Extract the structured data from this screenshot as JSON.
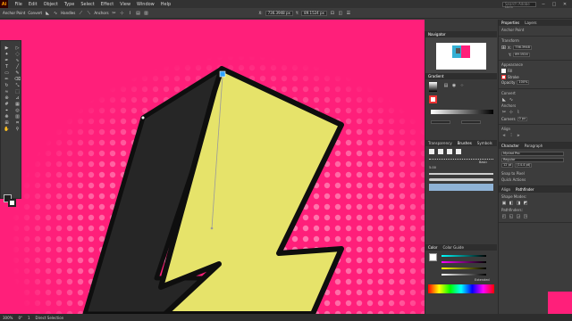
{
  "app": {
    "logo": "Ai"
  },
  "menu": [
    "File",
    "Edit",
    "Object",
    "Type",
    "Select",
    "Effect",
    "View",
    "Window",
    "Help"
  ],
  "search": {
    "placeholder": "Search Adobe Help"
  },
  "window_controls": [
    "─",
    "□",
    "✕"
  ],
  "control_bar": {
    "anchor_label": "Anchor Point",
    "convert_label": "Convert",
    "handles_label": "Handles",
    "anchors_label": "Anchors",
    "x_value": "736.3948 px",
    "y_value": "89.1524 px"
  },
  "tools": [
    "pointer",
    "direct-select",
    "magic-wand",
    "lasso",
    "pen",
    "curvature",
    "type",
    "line",
    "rectangle",
    "paintbrush",
    "pencil",
    "eraser",
    "rotate",
    "scale",
    "warp",
    "free-transform",
    "shape-builder",
    "perspective",
    "mesh",
    "gradient",
    "eyedropper",
    "blend",
    "symbol-sprayer",
    "column-graph",
    "artboard",
    "slice",
    "hand",
    "zoom"
  ],
  "navigator": {
    "tab": "Navigator"
  },
  "gradient": {
    "tab": "Gradient"
  },
  "transparency": {
    "tabs": [
      "Transparency",
      "Brushes",
      "Symbols"
    ]
  },
  "brushes": {
    "size_label": "Basic",
    "stroke_value": "5.00"
  },
  "color": {
    "tabs": [
      "Color",
      "Color Guide"
    ],
    "expand": "Cmyk",
    "extended_label": "Extended"
  },
  "properties": {
    "tabs": [
      "Properties",
      "Layers"
    ],
    "selection": "Anchor Point",
    "transform_title": "Transform",
    "x": "736.3948",
    "y": "89.1524",
    "appearance_title": "Appearance",
    "fill_label": "Fill",
    "stroke_label": "Stroke",
    "opacity_label": "Opacity",
    "opacity_value": "100%",
    "convert_title": "Convert",
    "anchors_title": "Anchors",
    "corners_label": "Corners",
    "corners_value": "0 px",
    "align_title": "Align",
    "character_tabs": [
      "Character",
      "Paragraph"
    ],
    "font_name": "Myriad Pro",
    "font_style": "Regular",
    "font_size": "12 pt",
    "leading": "(14.4 pt)",
    "snap_title": "Snap to Pixel",
    "quick_actions_title": "Quick Actions",
    "align_tabs": [
      "Align",
      "Pathfinder"
    ],
    "shape_modes": "Shape Modes:",
    "pathfinders": "Pathfinders:"
  },
  "status": {
    "zoom": "300%",
    "angle": "0°",
    "artboard": "1",
    "tool": "Direct Selection"
  },
  "colors": {
    "canvas_pink": "#ff1f7a",
    "bolt_yellow": "#e6e36a",
    "bolt_dark": "#262626",
    "ui_dark": "#3a3a3a"
  }
}
